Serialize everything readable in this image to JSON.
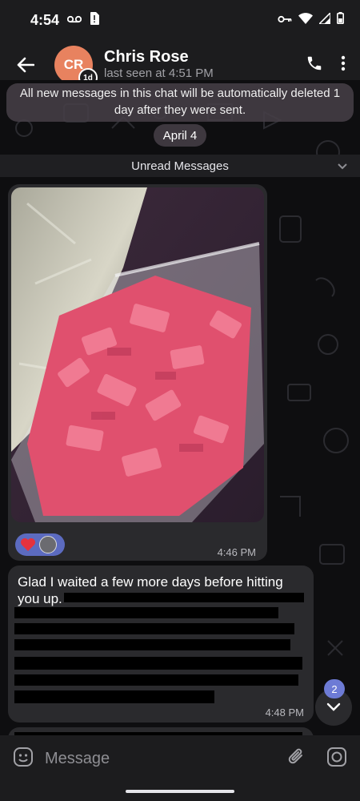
{
  "status_bar": {
    "time": "4:54",
    "left_icons": [
      "voicemail-icon",
      "sim-alert-icon"
    ],
    "right_icons": [
      "vpn-key-icon",
      "wifi-icon",
      "signal-icon",
      "battery-icon"
    ]
  },
  "header": {
    "avatar_initials": "CR",
    "timer_label": "1d",
    "contact_name": "Chris Rose",
    "last_seen": "last seen at 4:51 PM",
    "actions": [
      "phone-icon",
      "more-vert-icon"
    ]
  },
  "chat": {
    "service_message": "All new messages in this chat will be automatically deleted 1 day after they were sent.",
    "date_label": "April 4",
    "unread_label": "Unread Messages",
    "photo_message": {
      "time": "4:46 PM",
      "reactions": [
        "heart-reaction",
        "reactor-avatar"
      ]
    },
    "text_message": {
      "visible_text": "Glad I waited a few more days before hitting you up.",
      "time": "4:48 PM"
    },
    "scroll_down_unread_count": "2"
  },
  "composer": {
    "placeholder": "Message",
    "icons": [
      "emoji-icon",
      "attach-icon",
      "camera-icon"
    ]
  },
  "colors": {
    "bar_bg": "#1c1c1e",
    "bubble_bg": "#2a2a2d",
    "avatar": "#e8825f",
    "accent": "#6d7bd5"
  }
}
